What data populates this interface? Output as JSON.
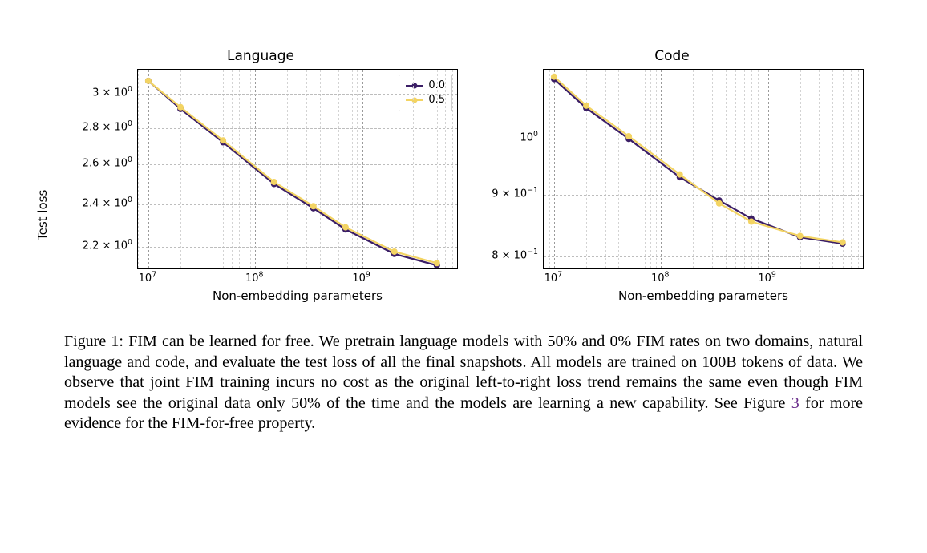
{
  "caption": {
    "prefix": "Figure 1: FIM can be learned for free.",
    "body1": "We pretrain language models with 50% and 0% FIM rates on two domains, natural language and code, and evaluate the test loss of all the final snapshots. All models are trained on 100B tokens of data. We observe that joint FIM training incurs no cost as the original left-to-right loss trend remains the same even though FIM models see the original data only 50% of the time and the models are learning a new capability. See Figure ",
    "link_text": "3",
    "body2": " for more evidence for the FIM-for-free property."
  },
  "ylabel": "Test loss",
  "legend": {
    "series0": {
      "label": "0.0",
      "color": "#3b1e66"
    },
    "series1": {
      "label": "0.5",
      "color": "#f3d463"
    }
  },
  "chart_data": [
    {
      "type": "line",
      "title": "Language",
      "xlabel": "Non-embedding parameters",
      "ylabel": "Test loss",
      "xscale": "log",
      "yscale": "log",
      "xlim": [
        8000000.0,
        8000000000.0
      ],
      "ylim": [
        2.1,
        3.15
      ],
      "x": [
        10000000.0,
        20000000.0,
        50000000.0,
        150000000.0,
        350000000.0,
        700000000.0,
        2000000000.0,
        5000000000.0
      ],
      "series": [
        {
          "name": "0.0",
          "color": "#3b1e66",
          "values": [
            3.08,
            2.91,
            2.72,
            2.5,
            2.38,
            2.28,
            2.17,
            2.12
          ]
        },
        {
          "name": "0.5",
          "color": "#f3d463",
          "values": [
            3.08,
            2.92,
            2.73,
            2.51,
            2.39,
            2.29,
            2.18,
            2.13
          ]
        }
      ],
      "xticks_major_html": [
        "10<sup>7</sup>",
        "10<sup>8</sup>",
        "10<sup>9</sup>"
      ],
      "xticks_major": [
        10000000.0,
        100000000.0,
        1000000000.0
      ],
      "yticks_major_html": [
        "2.2 × 10<sup>0</sup>",
        "2.4 × 10<sup>0</sup>",
        "2.6 × 10<sup>0</sup>",
        "2.8 × 10<sup>0</sup>",
        "3 × 10<sup>0</sup>"
      ],
      "yticks_major": [
        2.2,
        2.4,
        2.6,
        2.8,
        3.0
      ]
    },
    {
      "type": "line",
      "title": "Code",
      "xlabel": "Non-embedding parameters",
      "ylabel": "Test loss",
      "xscale": "log",
      "yscale": "log",
      "xlim": [
        8000000.0,
        8000000000.0
      ],
      "ylim": [
        0.78,
        1.14
      ],
      "x": [
        10000000.0,
        20000000.0,
        50000000.0,
        150000000.0,
        350000000.0,
        700000000.0,
        2000000000.0,
        5000000000.0
      ],
      "series": [
        {
          "name": "0.0",
          "color": "#3b1e66",
          "values": [
            1.12,
            1.06,
            1.0,
            0.93,
            0.89,
            0.86,
            0.83,
            0.82
          ]
        },
        {
          "name": "0.5",
          "color": "#f3d463",
          "values": [
            1.125,
            1.065,
            1.005,
            0.935,
            0.885,
            0.855,
            0.832,
            0.822
          ]
        }
      ],
      "xticks_major_html": [
        "10<sup>7</sup>",
        "10<sup>8</sup>",
        "10<sup>9</sup>"
      ],
      "xticks_major": [
        10000000.0,
        100000000.0,
        1000000000.0
      ],
      "yticks_major_html": [
        "8 × 10<sup>−1</sup>",
        "9 × 10<sup>−1</sup>",
        "10<sup>0</sup>"
      ],
      "yticks_major": [
        0.8,
        0.9,
        1.0
      ]
    }
  ]
}
